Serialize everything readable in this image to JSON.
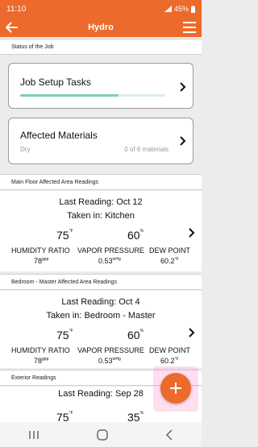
{
  "status_bar": {
    "time": "11:10",
    "battery": "45%"
  },
  "app_bar": {
    "title": "Hydro"
  },
  "status_section": {
    "label": "Status of the Job"
  },
  "job_setup": {
    "title": "Job Setup Tasks",
    "progress": 0.68
  },
  "affected_materials": {
    "title": "Affected Materials",
    "status": "Dry",
    "count": "0 of 6 materials"
  },
  "readings": [
    {
      "header": "Main Floor Affected Area Readings",
      "last_reading": "Last Reading: Oct 12",
      "taken_in": "Taken in: Kitchen",
      "temp": "75",
      "temp_unit": "°F",
      "humidity": "60",
      "humidity_unit": "%",
      "humidity_ratio_label": "HUMIDITY RATIO",
      "humidity_ratio": "78",
      "humidity_ratio_unit": "gpp",
      "vapor_pressure_label": "VAPOR PRESSURE",
      "vapor_pressure": "0.53",
      "vapor_pressure_unit": "inHg",
      "dew_point_label": "DEW POINT",
      "dew_point": "60.2",
      "dew_point_unit": "°F"
    },
    {
      "header": "Bedroom - Master Affected Area Readings",
      "last_reading": "Last Reading: Oct 4",
      "taken_in": "Taken in: Bedroom - Master",
      "temp": "75",
      "temp_unit": "°F",
      "humidity": "60",
      "humidity_unit": "%",
      "humidity_ratio_label": "HUMIDITY RATIO",
      "humidity_ratio": "78",
      "humidity_ratio_unit": "gpp",
      "vapor_pressure_label": "VAPOR PRESSURE",
      "vapor_pressure": "0.53",
      "vapor_pressure_unit": "inHg",
      "dew_point_label": "DEW POINT",
      "dew_point": "60.2",
      "dew_point_unit": "°F"
    },
    {
      "header": "Exterior Readings",
      "last_reading": "Last Reading: Sep 28",
      "temp": "75",
      "temp_unit": "°F",
      "humidity": "35",
      "humidity_unit": "%"
    }
  ],
  "colors": {
    "brand": "#ec6a2b",
    "progress": "#7ed0b3"
  }
}
